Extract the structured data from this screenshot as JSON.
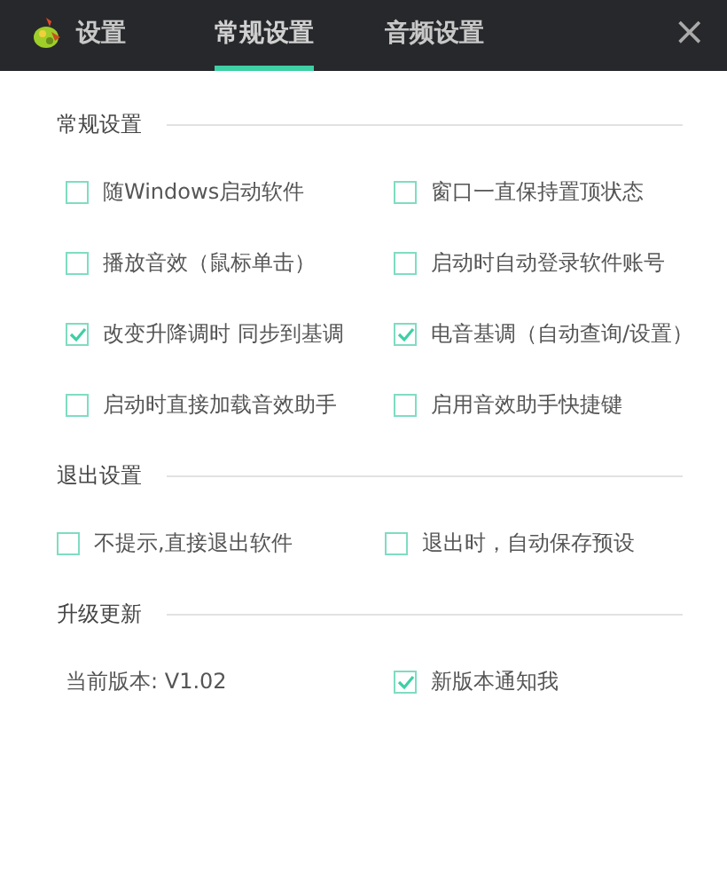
{
  "tabs": [
    {
      "label": "设置",
      "selected": false,
      "kind": "logo"
    },
    {
      "label": "常规设置",
      "selected": true,
      "kind": "tab"
    },
    {
      "label": "音频设置",
      "selected": false,
      "kind": "tab"
    }
  ],
  "close": "×",
  "sections": [
    {
      "title": "常规设置",
      "items": [
        {
          "kind": "checkbox",
          "label": "随Windows启动软件",
          "checked": false
        },
        {
          "kind": "checkbox",
          "label": "窗口一直保持置顶状态",
          "checked": false
        },
        {
          "kind": "checkbox",
          "label": "播放音效（鼠标单击）",
          "checked": false
        },
        {
          "kind": "checkbox",
          "label": "启动时自动登录软件账号",
          "checked": false
        },
        {
          "kind": "checkbox",
          "label": "改变升降调时 同步到基调",
          "checked": true
        },
        {
          "kind": "checkbox",
          "label": "电音基调（自动查询/设置）",
          "checked": true
        },
        {
          "kind": "checkbox",
          "label": "启动时直接加载音效助手",
          "checked": false
        },
        {
          "kind": "checkbox",
          "label": "启用音效助手快捷键",
          "checked": false
        }
      ]
    },
    {
      "title": "退出设置",
      "items": [
        {
          "kind": "checkbox",
          "label": "不提示,直接退出软件",
          "checked": false
        },
        {
          "kind": "checkbox",
          "label": "退出时，自动保存预设",
          "checked": false
        }
      ]
    },
    {
      "title": "升级更新",
      "items": [
        {
          "kind": "text",
          "label": "当前版本: V1.02"
        },
        {
          "kind": "checkbox",
          "label": "新版本通知我",
          "checked": true
        }
      ]
    }
  ]
}
